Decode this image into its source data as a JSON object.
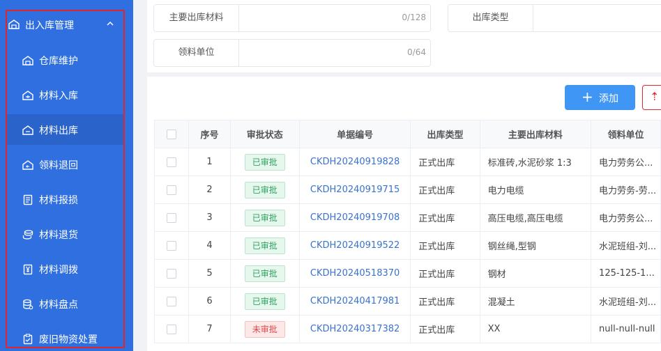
{
  "sidebar": {
    "group_label": "出入库管理",
    "items": [
      {
        "label": "仓库维护",
        "icon": "warehouse-icon"
      },
      {
        "label": "材料入库",
        "icon": "warehouse-in-icon"
      },
      {
        "label": "材料出库",
        "icon": "warehouse-out-icon",
        "active": true
      },
      {
        "label": "领料退回",
        "icon": "return-box-icon"
      },
      {
        "label": "材料报损",
        "icon": "document-icon"
      },
      {
        "label": "材料退货",
        "icon": "coins-icon"
      },
      {
        "label": "材料调拨",
        "icon": "yen-doc-icon"
      },
      {
        "label": "材料盘点",
        "icon": "database-icon"
      },
      {
        "label": "废旧物资处置",
        "icon": "clipboard-check-icon"
      }
    ]
  },
  "search": {
    "main_material_label": "主要出库材料",
    "main_material_count": "0/128",
    "out_type_label": "出库类型",
    "unit_label": "领料单位",
    "unit_count": "0/64"
  },
  "toolbar": {
    "add_label": "添加"
  },
  "table": {
    "headers": [
      "序号",
      "审批状态",
      "单据编号",
      "出库类型",
      "主要出库材料",
      "领料单位"
    ],
    "rows": [
      {
        "no": "1",
        "status": "已审批",
        "doc": "CKDH20240919828",
        "type": "正式出库",
        "material": "标准砖,水泥砂浆 1:3",
        "unit": "电力劳务公..."
      },
      {
        "no": "2",
        "status": "已审批",
        "doc": "CKDH20240919715",
        "type": "正式出库",
        "material": "电力电缆",
        "unit": "电力劳务-劳..."
      },
      {
        "no": "3",
        "status": "已审批",
        "doc": "CKDH20240919708",
        "type": "正式出库",
        "material": "高压电缆,高压电缆",
        "unit": "电力劳务公..."
      },
      {
        "no": "4",
        "status": "已审批",
        "doc": "CKDH20240919522",
        "type": "正式出库",
        "material": "钢丝绳,型钢",
        "unit": "水泥班组-刘..."
      },
      {
        "no": "5",
        "status": "已审批",
        "doc": "CKDH20240518370",
        "type": "正式出库",
        "material": "钢材",
        "unit": "125-125-1..."
      },
      {
        "no": "6",
        "status": "已审批",
        "doc": "CKDH20240417981",
        "type": "正式出库",
        "material": "混凝土",
        "unit": "水泥班组-刘..."
      },
      {
        "no": "7",
        "status": "未审批",
        "doc": "CKDH20240317382",
        "type": "正式出库",
        "material": "XX",
        "unit": "null-null-null"
      }
    ]
  }
}
